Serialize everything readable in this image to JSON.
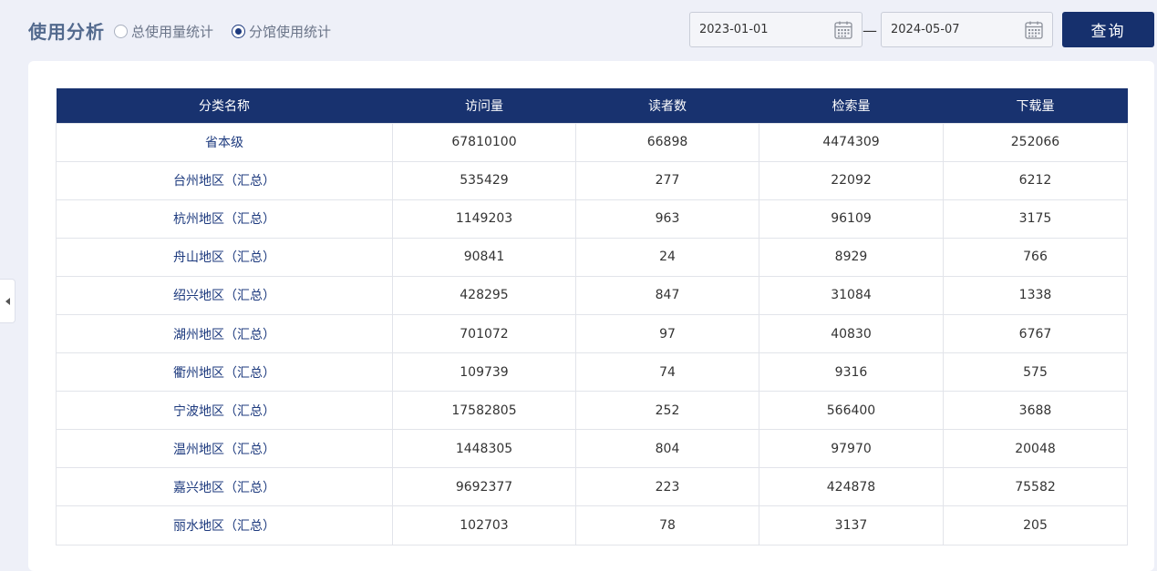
{
  "header": {
    "title": "使用分析",
    "radio_options": [
      {
        "label": "总使用量统计",
        "checked": false
      },
      {
        "label": "分馆使用统计",
        "checked": true
      }
    ],
    "date_start": "2023-01-01",
    "date_separator": "—",
    "date_end": "2024-05-07",
    "query_label": "查询"
  },
  "colors": {
    "primary": "#16306d",
    "name_text": "#1d3a7e",
    "background": "#eef0f8"
  },
  "table": {
    "columns": [
      "分类名称",
      "访问量",
      "读者数",
      "检索量",
      "下载量"
    ],
    "rows": [
      [
        "省本级",
        "67810100",
        "66898",
        "4474309",
        "252066"
      ],
      [
        "台州地区（汇总）",
        "535429",
        "277",
        "22092",
        "6212"
      ],
      [
        "杭州地区（汇总）",
        "1149203",
        "963",
        "96109",
        "3175"
      ],
      [
        "舟山地区（汇总）",
        "90841",
        "24",
        "8929",
        "766"
      ],
      [
        "绍兴地区（汇总）",
        "428295",
        "847",
        "31084",
        "1338"
      ],
      [
        "湖州地区（汇总）",
        "701072",
        "97",
        "40830",
        "6767"
      ],
      [
        "衢州地区（汇总）",
        "109739",
        "74",
        "9316",
        "575"
      ],
      [
        "宁波地区（汇总）",
        "17582805",
        "252",
        "566400",
        "3688"
      ],
      [
        "温州地区（汇总）",
        "1448305",
        "804",
        "97970",
        "20048"
      ],
      [
        "嘉兴地区（汇总）",
        "9692377",
        "223",
        "424878",
        "75582"
      ],
      [
        "丽水地区（汇总）",
        "102703",
        "78",
        "3137",
        "205"
      ]
    ]
  }
}
